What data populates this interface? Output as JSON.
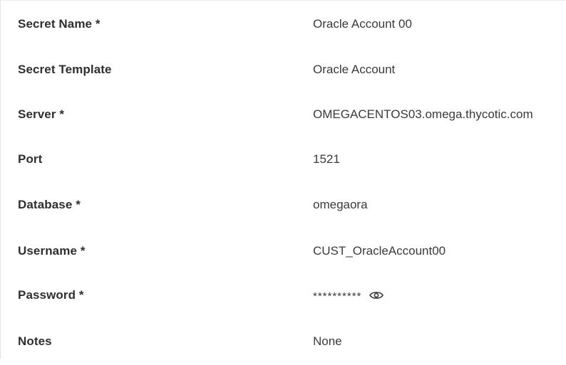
{
  "fields": [
    {
      "label": "Secret Name *",
      "value": "Oracle Account 00"
    },
    {
      "label": "Secret Template",
      "value": "Oracle Account"
    },
    {
      "label": "Server *",
      "value": "OMEGACENTOS03.omega.thycotic.com"
    },
    {
      "label": "Port",
      "value": "1521"
    },
    {
      "label": "Database *",
      "value": "omegaora"
    },
    {
      "label": "Username *",
      "value": "CUST_OracleAccount00"
    },
    {
      "label": "Password *",
      "value": "**********",
      "icon": "eye-icon"
    },
    {
      "label": "Notes",
      "value": "None"
    }
  ]
}
